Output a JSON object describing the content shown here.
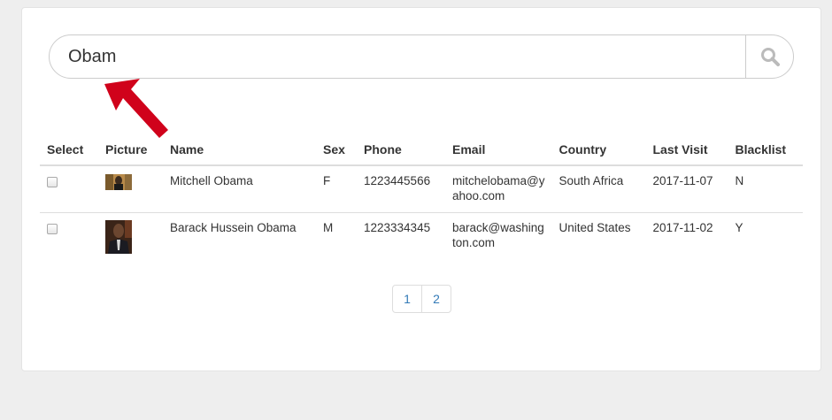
{
  "search": {
    "value": "Obam",
    "icon": "search-icon"
  },
  "table": {
    "headers": [
      "Select",
      "Picture",
      "Name",
      "Sex",
      "Phone",
      "Email",
      "Country",
      "Last Visit",
      "Blacklist"
    ],
    "rows": [
      {
        "name": "Mitchell Obama",
        "sex": "F",
        "phone": "1223445566",
        "email_line1": "mitchelobama@y",
        "email_line2": "ahoo.com",
        "country": "South Africa",
        "last_visit": "2017-11-07",
        "blacklist": "N"
      },
      {
        "name": "Barack Hussein Obama",
        "sex": "M",
        "phone": "1223334345",
        "email_line1": "barack@washing",
        "email_line2": "ton.com",
        "country": "United States",
        "last_visit": "2017-11-02",
        "blacklist": "Y"
      }
    ]
  },
  "pagination": {
    "pages": [
      "1",
      "2"
    ]
  },
  "colors": {
    "arrow": "#d0021b",
    "link": "#337ab7",
    "border": "#dddddd",
    "background": "#eeeeee"
  }
}
